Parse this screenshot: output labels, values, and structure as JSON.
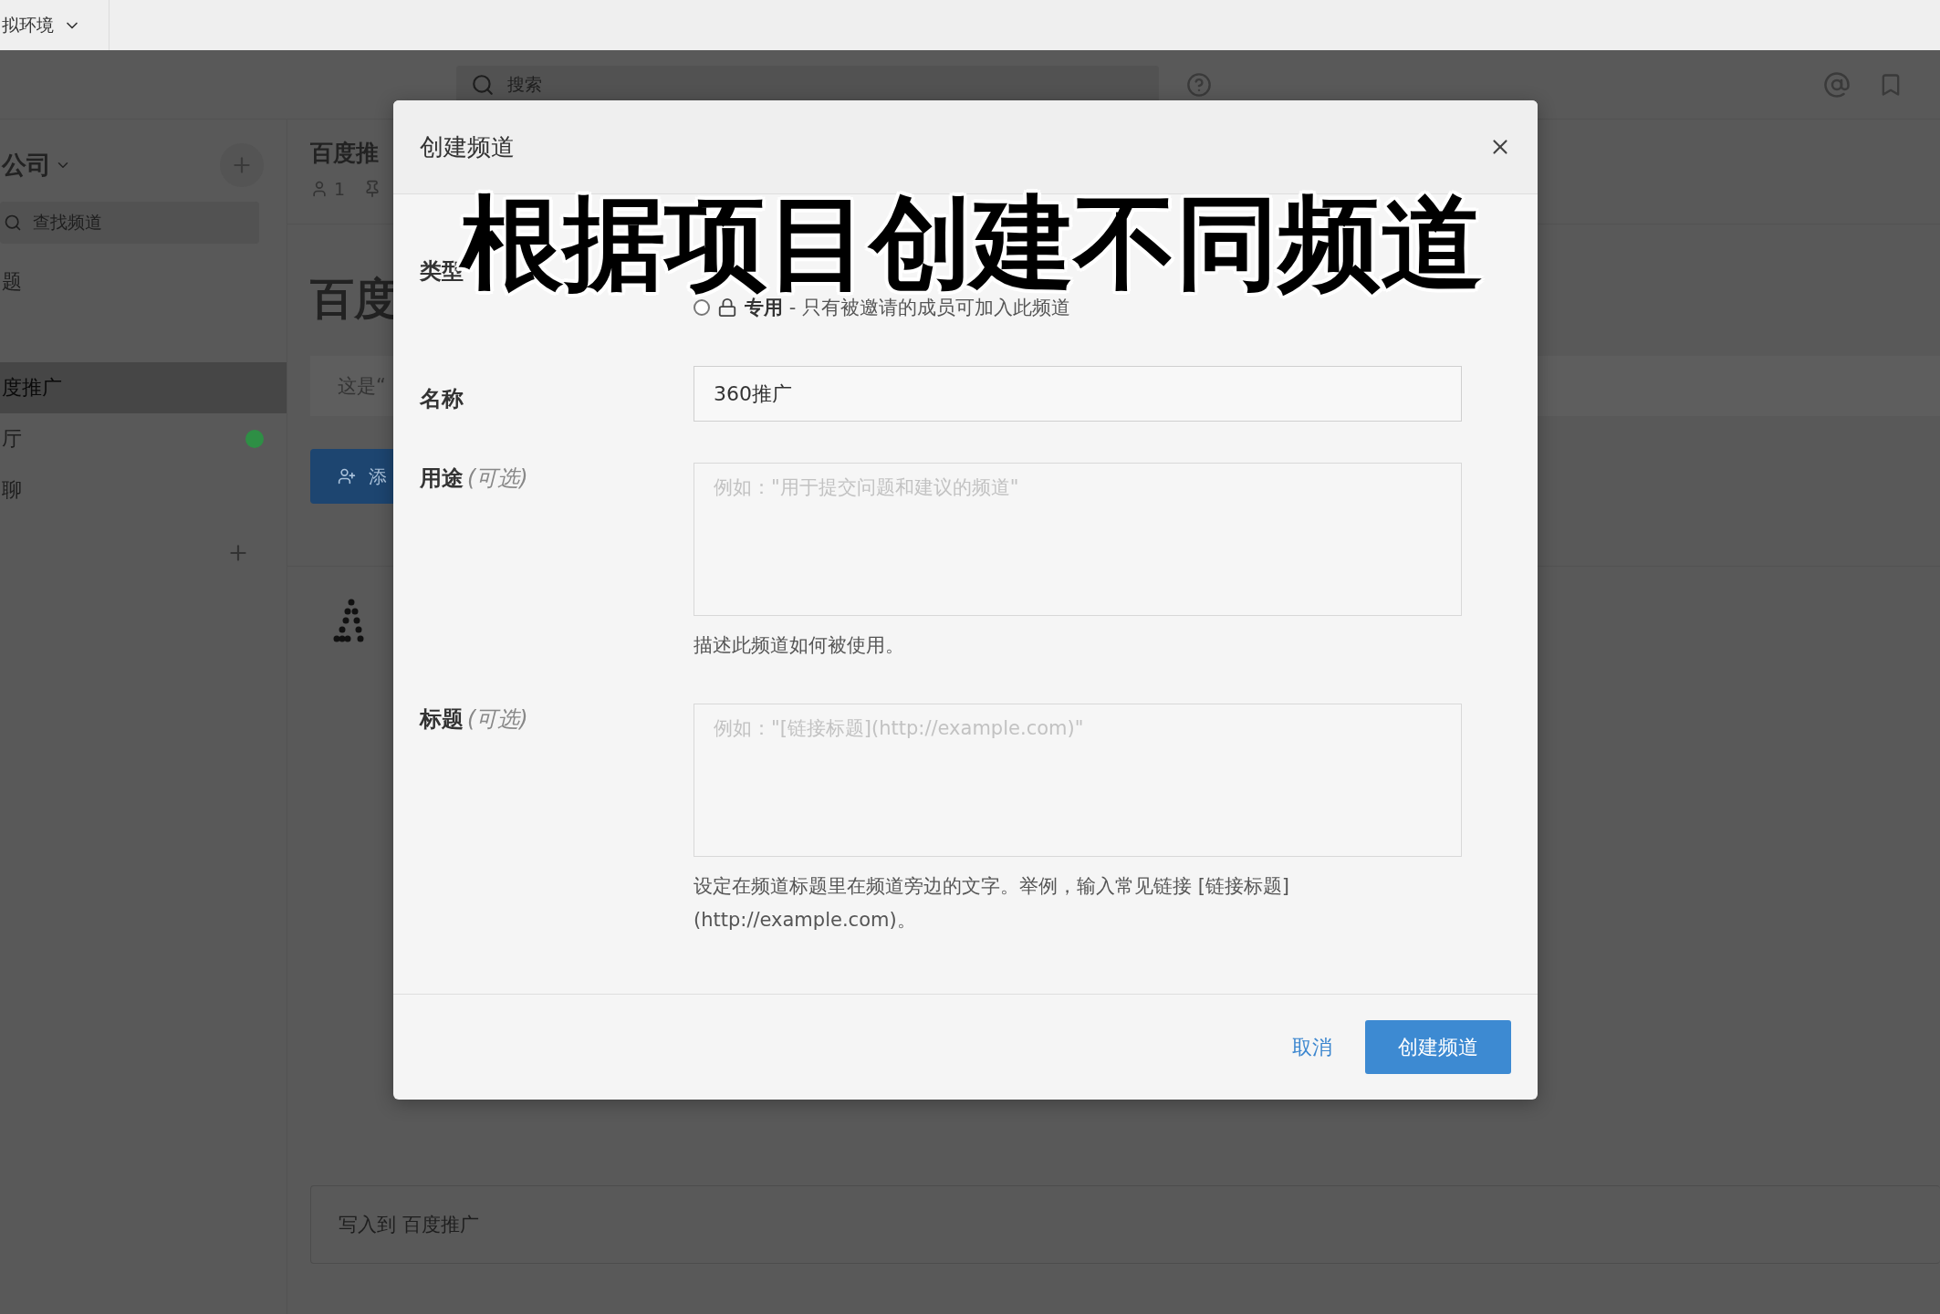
{
  "top_bar": {
    "environment": "拟环境"
  },
  "header": {
    "search": {
      "placeholder": "搜索"
    }
  },
  "sidebar": {
    "team": "公司",
    "find_channel": {
      "placeholder": "查找频道"
    },
    "items": [
      {
        "label": "题",
        "selected": false,
        "dot": false
      },
      {
        "label": "度推广",
        "selected": true,
        "dot": false
      },
      {
        "label": "厅",
        "selected": false,
        "dot": true
      },
      {
        "label": "聊",
        "selected": false,
        "dot": false
      }
    ]
  },
  "channel": {
    "name": "百度推",
    "members": "1",
    "heading": "百度",
    "intro": "这是“",
    "button_label": "添"
  },
  "composer": {
    "placeholder": "写入到 百度推广"
  },
  "dialog": {
    "title": "创建频道",
    "type": {
      "label": "类型",
      "options": [
        {
          "label": "专用",
          "description": " - 只有被邀请的成员可加入此频道",
          "selected": false
        }
      ]
    },
    "name": {
      "label": "名称",
      "value": "360推广"
    },
    "purpose": {
      "label": "用途",
      "optional": "(可选)",
      "placeholder": "例如：\"用于提交问题和建议的频道\"",
      "help": "描述此频道如何被使用。"
    },
    "header": {
      "label": "标题",
      "optional": "(可选)",
      "placeholder": "例如：\"[链接标题](http://example.com)\"",
      "help": "设定在频道标题里在频道旁边的文字。举例，输入常见链接 [链接标题](http://example.com)。"
    },
    "buttons": [
      {
        "kind": "link",
        "label": "取消"
      },
      {
        "kind": "primary",
        "label": "创建频道"
      }
    ]
  },
  "caption": "根据项目创建不同频道"
}
